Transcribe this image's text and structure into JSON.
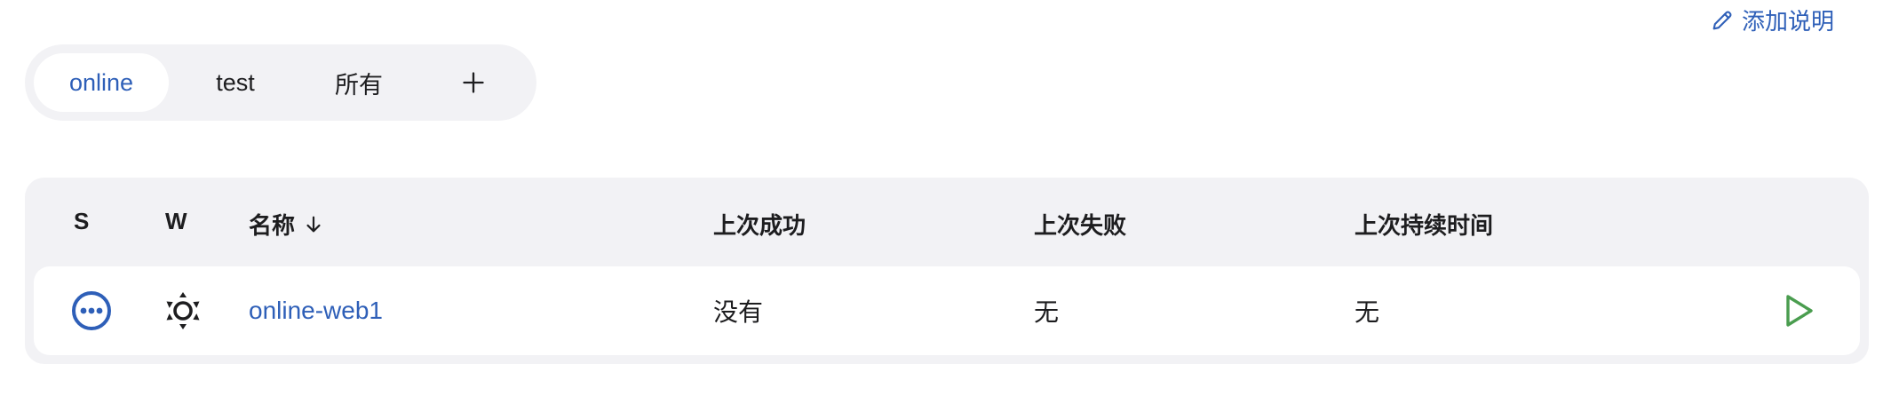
{
  "header": {
    "add_description_label": "添加说明",
    "edit_icon": "pencil-icon"
  },
  "tabs": [
    {
      "label": "online",
      "active": true
    },
    {
      "label": "test",
      "active": false
    },
    {
      "label": "所有",
      "active": false
    }
  ],
  "add_tab_icon": "plus-icon",
  "table": {
    "columns": {
      "status": "S",
      "weather": "W",
      "name": "名称",
      "name_sort": "↓",
      "last_success": "上次成功",
      "last_failure": "上次失败",
      "last_duration": "上次持续时间"
    },
    "rows": [
      {
        "status_icon": "pending-ellipsis-icon",
        "weather_icon": "sunny-icon",
        "name": "online-web1",
        "last_success": "没有",
        "last_failure": "无",
        "last_duration": "无",
        "action_icon": "run-build-icon"
      }
    ]
  },
  "colors": {
    "accent": "#2e5fb8",
    "panel_bg": "#f2f2f5",
    "run_green": "#4a9d4f"
  }
}
